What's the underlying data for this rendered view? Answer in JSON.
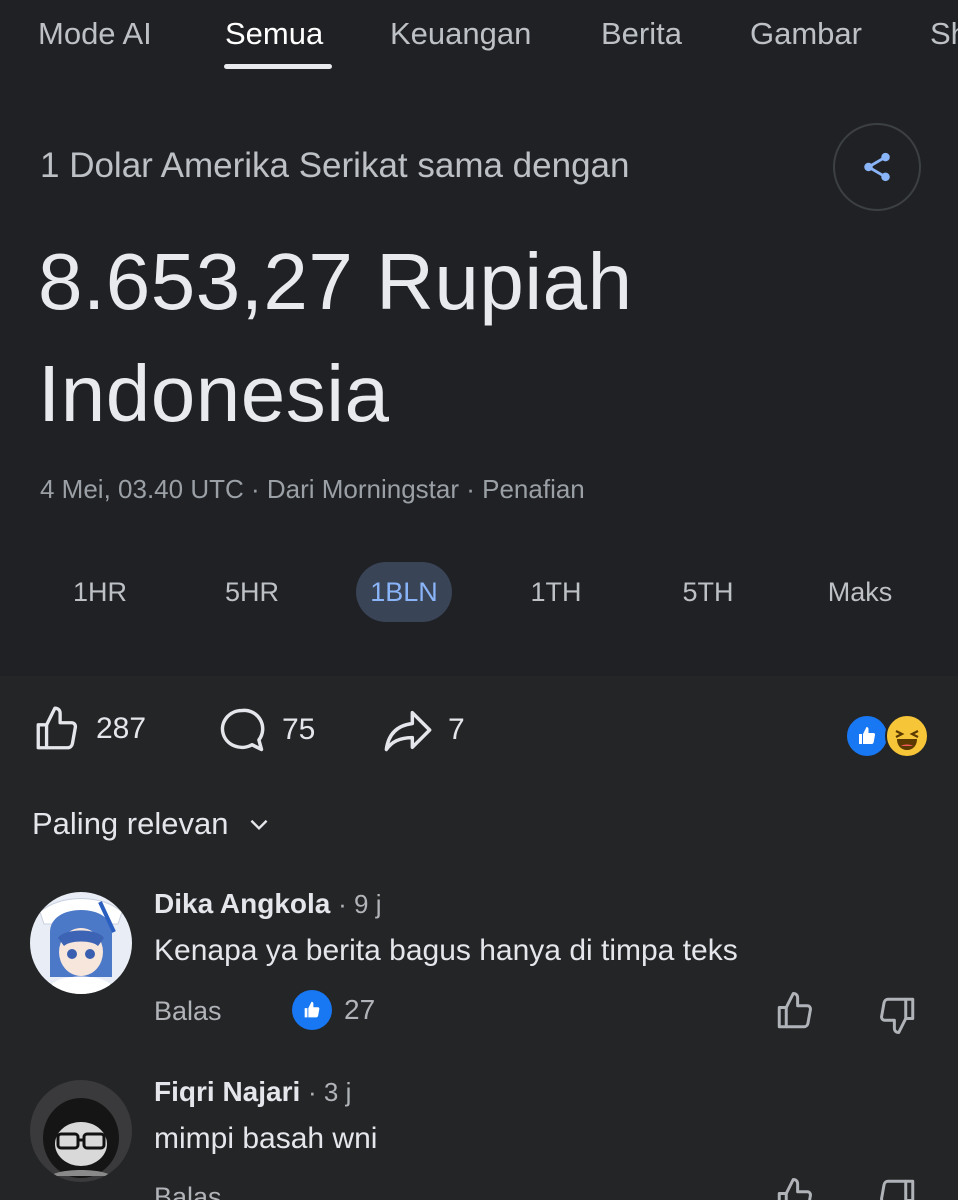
{
  "tabs": [
    "Mode AI",
    "Semua",
    "Keuangan",
    "Berita",
    "Gambar",
    "Sh"
  ],
  "active_tab": "Semua",
  "converter": {
    "label": "1 Dolar Amerika Serikat sama dengan",
    "value": "8.653,27 Rupiah Indonesia",
    "meta": "4 Mei, 03.40 UTC · Dari Morningstar · Penafian",
    "ranges": [
      "1HR",
      "5HR",
      "1BLN",
      "1TH",
      "5TH",
      "Maks"
    ],
    "active_range": "1BLN"
  },
  "post_stats": {
    "likes": "287",
    "comments": "75",
    "shares": "7"
  },
  "sort_label": "Paling relevan",
  "comments": [
    {
      "name": "Dika Angkola",
      "time": "· 9 j",
      "text": "Kenapa ya berita bagus hanya di timpa teks",
      "reply": "Balas",
      "likes": "27"
    },
    {
      "name": "Fiqri Najari",
      "time": "· 3 j",
      "text": "mimpi basah wni",
      "reply": "Balas"
    }
  ],
  "colors": {
    "google_bg": "#202124",
    "fb_bg": "#242526",
    "accent_blue": "#8ab4f8",
    "like_blue": "#1877f2"
  },
  "icons": [
    "share-icon",
    "like-icon",
    "comment-icon",
    "share-arrow-icon",
    "chevron-down-icon",
    "thumbs-up-icon",
    "thumbs-down-icon"
  ]
}
